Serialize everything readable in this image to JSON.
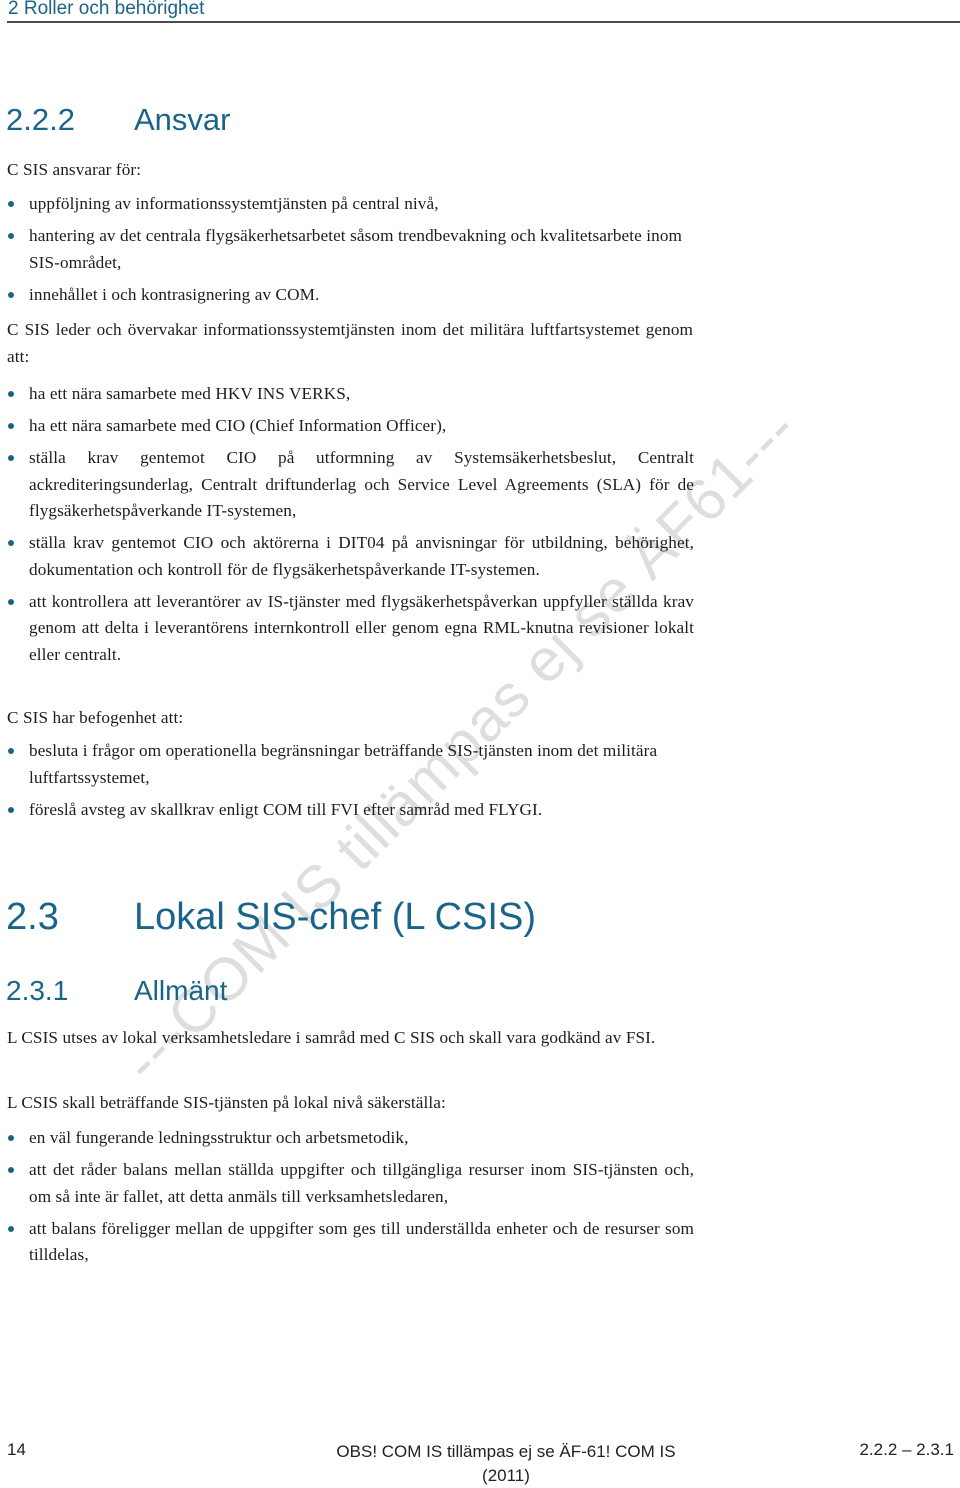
{
  "header": {
    "running_title": "2  Roller och behörighet"
  },
  "section_222": {
    "number": "2.2.2",
    "title": "Ansvar",
    "intro1": "C SIS ansvarar för:",
    "list1": [
      "uppföljning av informationssystemtjänsten på central nivå,",
      "hantering av det centrala flygsäkerhetsarbetet såsom trendbevakning och kvalitetsarbete inom SIS-området,",
      "innehållet i och kontrasignering av COM."
    ],
    "intro2": "C SIS leder och övervakar informationssystemtjänsten inom det militära luftfartsystemet genom att:",
    "list2": [
      "ha ett nära samarbete med HKV INS VERKS,",
      "ha ett nära samarbete med CIO (Chief Information Officer),",
      "ställa krav gentemot CIO på utformning av Systemsäkerhetsbeslut, Centralt ackrediteringsunderlag, Centralt driftunderlag och Service Level Agreements (SLA) för de flygsäkerhetspåverkande IT-systemen,",
      "ställa krav gentemot CIO och aktörerna i DIT04 på anvisningar för utbildning, behörighet, dokumentation och kontroll för de flygsäkerhetspåverkande IT-systemen.",
      "att kontrollera att leverantörer av IS-tjänster med flygsäkerhetspåverkan uppfyller ställda krav genom att delta i leverantörens internkontroll eller genom egna RML-knutna revisioner lokalt eller centralt."
    ],
    "intro3": "C SIS har befogenhet att:",
    "list3": [
      "besluta i frågor om operationella begränsningar beträffande SIS-tjänsten inom det militära luftfartssystemet,",
      "föreslå avsteg av skallkrav enligt COM till FVI efter samråd med FLYGI."
    ]
  },
  "section_23": {
    "number": "2.3",
    "title": "Lokal SIS-chef (L CSIS)"
  },
  "section_231": {
    "number": "2.3.1",
    "title": "Allmänt",
    "para1": "L CSIS utses av lokal verksamhetsledare i samråd med C SIS och skall vara godkänd av FSI.",
    "para2": "L CSIS skall beträffande SIS-tjänsten på lokal nivå säkerställa:",
    "list": [
      "en väl fungerande ledningsstruktur och arbetsmetodik,",
      "att det råder balans mellan ställda uppgifter och tillgängliga resurser inom SIS-tjänsten och, om så inte är fallet, att detta anmäls till verksamhetsledaren,",
      "att balans föreligger mellan de uppgifter som ges till underställda enheter och de resurser som tilldelas,"
    ]
  },
  "watermark": {
    "text": "---COM IS tillämpas ej se ÄF61---"
  },
  "footer": {
    "page_number": "14",
    "notice_line1": "OBS! COM IS tillämpas ej se ÄF-61! COM IS",
    "notice_line2": "(2011)",
    "section_range": "2.2.2 – 2.3.1"
  },
  "colors": {
    "heading": "#1a6489",
    "bullet": "#1a6489",
    "watermark": "#d9d9d9",
    "rule": "#4d4d4d"
  }
}
